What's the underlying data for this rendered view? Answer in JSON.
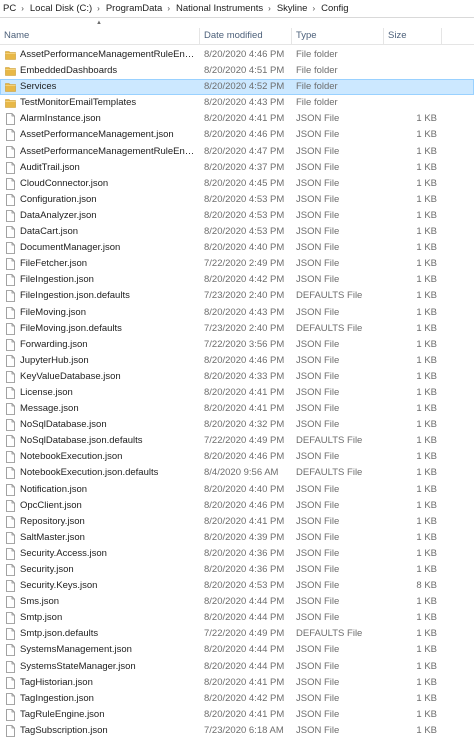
{
  "breadcrumb": [
    "PC",
    "Local Disk (C:)",
    "ProgramData",
    "National Instruments",
    "Skyline",
    "Config"
  ],
  "columns": {
    "name": "Name",
    "date": "Date modified",
    "type": "Type",
    "size": "Size"
  },
  "colors": {
    "selected_bg": "#cce8ff",
    "selected_border": "#99d1ff",
    "folder_yellow": "#e8b847",
    "header_text": "#4c607a"
  },
  "files": [
    {
      "name": "AssetPerformanceManagementRuleEngine",
      "date": "8/20/2020 4:46 PM",
      "type": "File folder",
      "size": "",
      "icon": "folder-icon"
    },
    {
      "name": "EmbeddedDashboards",
      "date": "8/20/2020 4:51 PM",
      "type": "File folder",
      "size": "",
      "icon": "folder-icon"
    },
    {
      "name": "Services",
      "date": "8/20/2020 4:52 PM",
      "type": "File folder",
      "size": "",
      "icon": "folder-icon",
      "selected": true
    },
    {
      "name": "TestMonitorEmailTemplates",
      "date": "8/20/2020 4:43 PM",
      "type": "File folder",
      "size": "",
      "icon": "folder-icon"
    },
    {
      "name": "AlarmInstance.json",
      "date": "8/20/2020 4:41 PM",
      "type": "JSON File",
      "size": "1 KB",
      "icon": "file-icon"
    },
    {
      "name": "AssetPerformanceManagement.json",
      "date": "8/20/2020 4:46 PM",
      "type": "JSON File",
      "size": "1 KB",
      "icon": "file-icon"
    },
    {
      "name": "AssetPerformanceManagementRuleEngi...",
      "date": "8/20/2020 4:47 PM",
      "type": "JSON File",
      "size": "1 KB",
      "icon": "file-icon"
    },
    {
      "name": "AuditTrail.json",
      "date": "8/20/2020 4:37 PM",
      "type": "JSON File",
      "size": "1 KB",
      "icon": "file-icon"
    },
    {
      "name": "CloudConnector.json",
      "date": "8/20/2020 4:45 PM",
      "type": "JSON File",
      "size": "1 KB",
      "icon": "file-icon"
    },
    {
      "name": "Configuration.json",
      "date": "8/20/2020 4:53 PM",
      "type": "JSON File",
      "size": "1 KB",
      "icon": "file-icon"
    },
    {
      "name": "DataAnalyzer.json",
      "date": "8/20/2020 4:53 PM",
      "type": "JSON File",
      "size": "1 KB",
      "icon": "file-icon"
    },
    {
      "name": "DataCart.json",
      "date": "8/20/2020 4:53 PM",
      "type": "JSON File",
      "size": "1 KB",
      "icon": "file-icon"
    },
    {
      "name": "DocumentManager.json",
      "date": "8/20/2020 4:40 PM",
      "type": "JSON File",
      "size": "1 KB",
      "icon": "file-icon"
    },
    {
      "name": "FileFetcher.json",
      "date": "7/22/2020 2:49 PM",
      "type": "JSON File",
      "size": "1 KB",
      "icon": "file-icon"
    },
    {
      "name": "FileIngestion.json",
      "date": "8/20/2020 4:42 PM",
      "type": "JSON File",
      "size": "1 KB",
      "icon": "file-icon"
    },
    {
      "name": "FileIngestion.json.defaults",
      "date": "7/23/2020 2:40 PM",
      "type": "DEFAULTS File",
      "size": "1 KB",
      "icon": "file-icon"
    },
    {
      "name": "FileMoving.json",
      "date": "8/20/2020 4:43 PM",
      "type": "JSON File",
      "size": "1 KB",
      "icon": "file-icon"
    },
    {
      "name": "FileMoving.json.defaults",
      "date": "7/23/2020 2:40 PM",
      "type": "DEFAULTS File",
      "size": "1 KB",
      "icon": "file-icon"
    },
    {
      "name": "Forwarding.json",
      "date": "7/22/2020 3:56 PM",
      "type": "JSON File",
      "size": "1 KB",
      "icon": "file-icon"
    },
    {
      "name": "JupyterHub.json",
      "date": "8/20/2020 4:46 PM",
      "type": "JSON File",
      "size": "1 KB",
      "icon": "file-icon"
    },
    {
      "name": "KeyValueDatabase.json",
      "date": "8/20/2020 4:33 PM",
      "type": "JSON File",
      "size": "1 KB",
      "icon": "file-icon"
    },
    {
      "name": "License.json",
      "date": "8/20/2020 4:41 PM",
      "type": "JSON File",
      "size": "1 KB",
      "icon": "file-icon"
    },
    {
      "name": "Message.json",
      "date": "8/20/2020 4:41 PM",
      "type": "JSON File",
      "size": "1 KB",
      "icon": "file-icon"
    },
    {
      "name": "NoSqlDatabase.json",
      "date": "8/20/2020 4:32 PM",
      "type": "JSON File",
      "size": "1 KB",
      "icon": "file-icon"
    },
    {
      "name": "NoSqlDatabase.json.defaults",
      "date": "7/22/2020 4:49 PM",
      "type": "DEFAULTS File",
      "size": "1 KB",
      "icon": "file-icon"
    },
    {
      "name": "NotebookExecution.json",
      "date": "8/20/2020 4:46 PM",
      "type": "JSON File",
      "size": "1 KB",
      "icon": "file-icon"
    },
    {
      "name": "NotebookExecution.json.defaults",
      "date": "8/4/2020 9:56 AM",
      "type": "DEFAULTS File",
      "size": "1 KB",
      "icon": "file-icon"
    },
    {
      "name": "Notification.json",
      "date": "8/20/2020 4:40 PM",
      "type": "JSON File",
      "size": "1 KB",
      "icon": "file-icon"
    },
    {
      "name": "OpcClient.json",
      "date": "8/20/2020 4:46 PM",
      "type": "JSON File",
      "size": "1 KB",
      "icon": "file-icon"
    },
    {
      "name": "Repository.json",
      "date": "8/20/2020 4:41 PM",
      "type": "JSON File",
      "size": "1 KB",
      "icon": "file-icon"
    },
    {
      "name": "SaltMaster.json",
      "date": "8/20/2020 4:39 PM",
      "type": "JSON File",
      "size": "1 KB",
      "icon": "file-icon"
    },
    {
      "name": "Security.Access.json",
      "date": "8/20/2020 4:36 PM",
      "type": "JSON File",
      "size": "1 KB",
      "icon": "file-icon"
    },
    {
      "name": "Security.json",
      "date": "8/20/2020 4:36 PM",
      "type": "JSON File",
      "size": "1 KB",
      "icon": "file-icon"
    },
    {
      "name": "Security.Keys.json",
      "date": "8/20/2020 4:53 PM",
      "type": "JSON File",
      "size": "8 KB",
      "icon": "file-icon"
    },
    {
      "name": "Sms.json",
      "date": "8/20/2020 4:44 PM",
      "type": "JSON File",
      "size": "1 KB",
      "icon": "file-icon"
    },
    {
      "name": "Smtp.json",
      "date": "8/20/2020 4:44 PM",
      "type": "JSON File",
      "size": "1 KB",
      "icon": "file-icon"
    },
    {
      "name": "Smtp.json.defaults",
      "date": "7/22/2020 4:49 PM",
      "type": "DEFAULTS File",
      "size": "1 KB",
      "icon": "file-icon"
    },
    {
      "name": "SystemsManagement.json",
      "date": "8/20/2020 4:44 PM",
      "type": "JSON File",
      "size": "1 KB",
      "icon": "file-icon"
    },
    {
      "name": "SystemsStateManager.json",
      "date": "8/20/2020 4:44 PM",
      "type": "JSON File",
      "size": "1 KB",
      "icon": "file-icon"
    },
    {
      "name": "TagHistorian.json",
      "date": "8/20/2020 4:41 PM",
      "type": "JSON File",
      "size": "1 KB",
      "icon": "file-icon"
    },
    {
      "name": "TagIngestion.json",
      "date": "8/20/2020 4:42 PM",
      "type": "JSON File",
      "size": "1 KB",
      "icon": "file-icon"
    },
    {
      "name": "TagRuleEngine.json",
      "date": "8/20/2020 4:41 PM",
      "type": "JSON File",
      "size": "1 KB",
      "icon": "file-icon"
    },
    {
      "name": "TagSubscription.json",
      "date": "7/23/2020 6:18 AM",
      "type": "JSON File",
      "size": "1 KB",
      "icon": "file-icon"
    }
  ]
}
